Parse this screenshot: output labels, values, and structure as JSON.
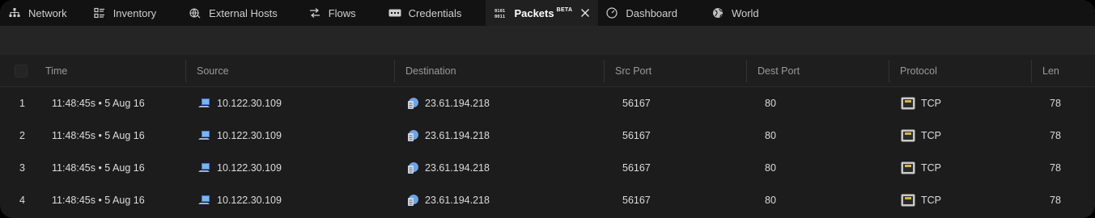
{
  "tabs": [
    {
      "label": "Network",
      "icon": "network-icon"
    },
    {
      "label": "Inventory",
      "icon": "inventory-icon"
    },
    {
      "label": "External Hosts",
      "icon": "external-hosts-icon"
    },
    {
      "label": "Flows",
      "icon": "flows-icon"
    },
    {
      "label": "Credentials",
      "icon": "credentials-icon"
    },
    {
      "label": "Packets",
      "badge": "BETA",
      "icon": "packets-icon",
      "active": true
    },
    {
      "label": "Dashboard",
      "icon": "dashboard-icon"
    },
    {
      "label": "World",
      "icon": "globe-icon"
    }
  ],
  "table": {
    "columns": [
      "Time",
      "Source",
      "Destination",
      "Src Port",
      "Dest Port",
      "Protocol",
      "Len"
    ],
    "rows": [
      {
        "num": "1",
        "time": "11:48:45s • 5 Aug 16",
        "source": "10.122.30.109",
        "destination": "23.61.194.218",
        "src_port": "56167",
        "dest_port": "80",
        "protocol": "TCP",
        "len": "78"
      },
      {
        "num": "2",
        "time": "11:48:45s • 5 Aug 16",
        "source": "10.122.30.109",
        "destination": "23.61.194.218",
        "src_port": "56167",
        "dest_port": "80",
        "protocol": "TCP",
        "len": "78"
      },
      {
        "num": "3",
        "time": "11:48:45s • 5 Aug 16",
        "source": "10.122.30.109",
        "destination": "23.61.194.218",
        "src_port": "56167",
        "dest_port": "80",
        "protocol": "TCP",
        "len": "78"
      },
      {
        "num": "4",
        "time": "11:48:45s • 5 Aug 16",
        "source": "10.122.30.109",
        "destination": "23.61.194.218",
        "src_port": "56167",
        "dest_port": "80",
        "protocol": "TCP",
        "len": "78"
      }
    ]
  },
  "colors": {
    "accent": "#3b7ddd",
    "background": "#1c1c1c",
    "tabbar": "#121212"
  }
}
